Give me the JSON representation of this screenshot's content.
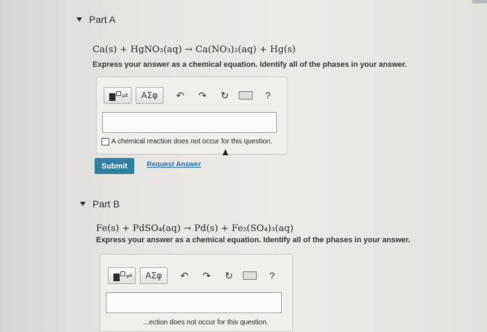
{
  "partA": {
    "title": "Part A",
    "equation": "Ca(s) + HgNO₃(aq) → Ca(NO₃)₂(aq) + Hg(s)",
    "instruction": "Express your answer as a chemical equation. Identify all of the phases in your answer.",
    "greek_label": "ΑΣφ",
    "help_label": "?",
    "answer_value": "",
    "checkbox_label": "A chemical reaction does not occur for this question.",
    "submit_label": "Submit",
    "request_label": "Request Answer"
  },
  "partB": {
    "title": "Part B",
    "equation": "Fe(s) + PdSO₄(aq) → Pd(s) + Fe₂(SO₄)₃(aq)",
    "instruction": "Express your answer as a chemical equation. Identify all of the phases in your answer.",
    "greek_label": "ΑΣφ",
    "help_label": "?",
    "answer_value": "",
    "checkbox_label": "...ection does not occur for this question."
  },
  "colors": {
    "submit_bg": "#2e7fa0",
    "link": "#2e6fa5"
  }
}
